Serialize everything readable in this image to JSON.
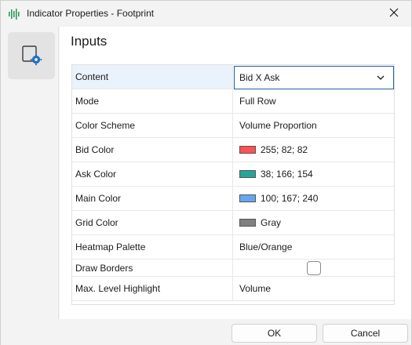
{
  "window": {
    "title": "Indicator Properties - Footprint",
    "app_icon": "waveform-icon",
    "close_icon": "close-icon"
  },
  "rail": {
    "items": [
      {
        "icon": "indicator-settings-icon",
        "selected": true
      }
    ]
  },
  "main": {
    "heading": "Inputs"
  },
  "properties": [
    {
      "name": "Content",
      "value": "Bid X Ask",
      "type": "dropdown",
      "selected": true
    },
    {
      "name": "Mode",
      "value": "Full Row",
      "type": "text"
    },
    {
      "name": "Color Scheme",
      "value": "Volume Proportion",
      "type": "text"
    },
    {
      "name": "Bid Color",
      "value": "255; 82; 82",
      "type": "color",
      "color": "#ff5252"
    },
    {
      "name": "Ask Color",
      "value": "38; 166; 154",
      "type": "color",
      "color": "#26a69a"
    },
    {
      "name": "Main Color",
      "value": "100; 167; 240",
      "type": "color",
      "color": "#64a7f0"
    },
    {
      "name": "Grid Color",
      "value": "Gray",
      "type": "color",
      "color": "#808080"
    },
    {
      "name": "Heatmap Palette",
      "value": "Blue/Orange",
      "type": "text"
    },
    {
      "name": "Draw Borders",
      "value": "",
      "type": "checkbox",
      "checked": false
    },
    {
      "name": "Max. Level Highlight",
      "value": "Volume",
      "type": "text"
    }
  ],
  "footer": {
    "ok_label": "OK",
    "cancel_label": "Cancel"
  },
  "colors": {
    "accent": "#0067c0",
    "focus_border": "#1f5fa8"
  }
}
